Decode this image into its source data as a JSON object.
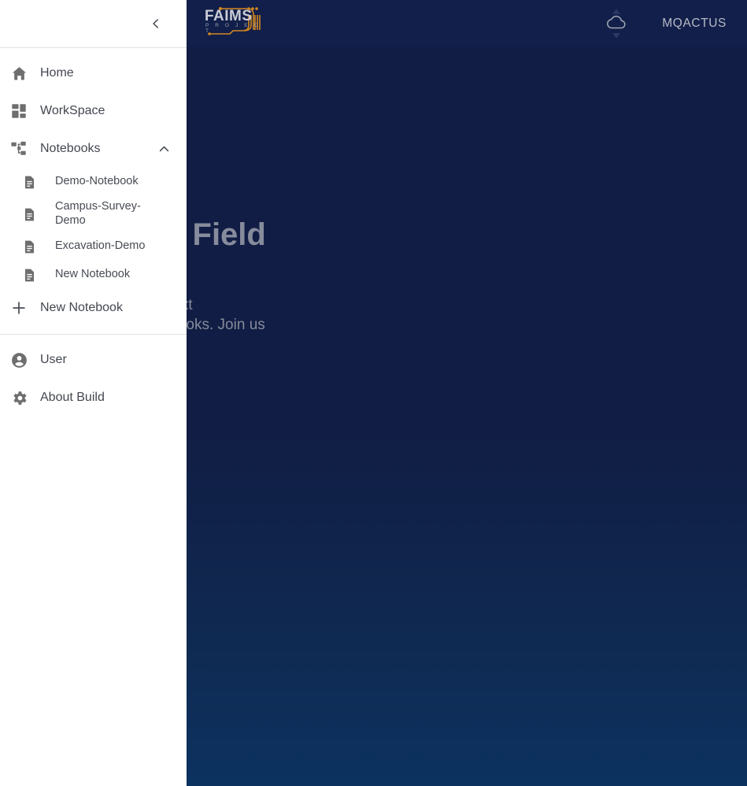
{
  "appbar": {
    "logo": {
      "name": "faims-logo",
      "title": "FAIMS",
      "subtitle": "P R O J E C T"
    },
    "sync_icon_name": "cloud-sync-icon",
    "username": "MQACTUS"
  },
  "hero": {
    "title": "Electronic Field",
    "body_line1": "We are building the next",
    "body_line2": "Electronic Field Notebooks. Join us"
  },
  "drawer": {
    "collapse_icon": "chevron-left-icon",
    "nav": [
      {
        "label": "Home",
        "icon": "home-icon"
      },
      {
        "label": "WorkSpace",
        "icon": "dashboard-icon"
      },
      {
        "label": "Notebooks",
        "icon": "account-tree-icon",
        "expanded": true,
        "chevron": "chevron-up-icon"
      }
    ],
    "notebooks": [
      {
        "label": "Demo-Notebook",
        "icon": "document-icon"
      },
      {
        "label": "Campus-Survey-Demo",
        "icon": "document-icon"
      },
      {
        "label": "Excavation-Demo",
        "icon": "document-icon"
      },
      {
        "label": "New Notebook",
        "icon": "document-icon"
      }
    ],
    "new_notebook": {
      "label": "New Notebook",
      "icon": "plus-icon"
    },
    "footer_nav": [
      {
        "label": "User",
        "icon": "account-circle-icon"
      },
      {
        "label": "About Build",
        "icon": "gear-icon"
      }
    ]
  },
  "colors": {
    "appbar_bg": "#121f4a",
    "page_bg_top": "#111d44",
    "page_bg_bottom": "#0c3260",
    "drawer_bg": "#ffffff",
    "accent_orange": "#d4881f",
    "muted_text": "#878c9c"
  }
}
